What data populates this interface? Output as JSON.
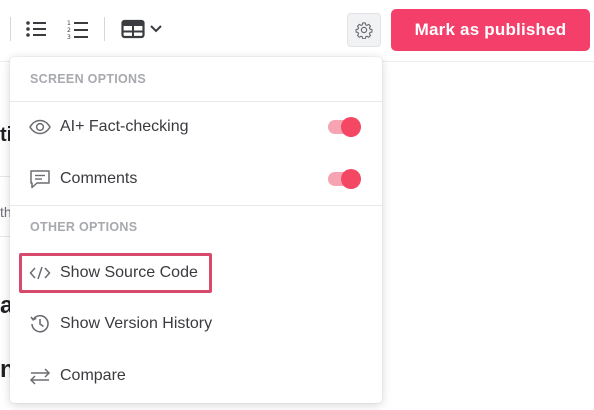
{
  "toolbar": {
    "bullet_list_icon": "bullet-list-icon",
    "numbered_list_icon": "numbered-list-icon",
    "table_icon": "table-icon",
    "gear_icon": "gear-icon",
    "publish_label": "Mark as published",
    "publish_color": "#f43f6b"
  },
  "background": {
    "frag1": "ti",
    "frag2": "th",
    "frag3": "a",
    "frag4": "n"
  },
  "dropdown": {
    "screen_options_title": "SCREEN OPTIONS",
    "other_options_title": "OTHER OPTIONS",
    "screen_options": [
      {
        "label": "AI+ Fact-checking",
        "icon": "eye-icon",
        "enabled": true
      },
      {
        "label": "Comments",
        "icon": "comment-icon",
        "enabled": true
      }
    ],
    "other_options": [
      {
        "label": "Show Source Code",
        "icon": "code-icon"
      },
      {
        "label": "Show Version History",
        "icon": "history-icon"
      },
      {
        "label": "Compare",
        "icon": "compare-arrows-icon"
      }
    ],
    "toggle_color": "#f34764",
    "highlight_color": "#d84a6c"
  }
}
